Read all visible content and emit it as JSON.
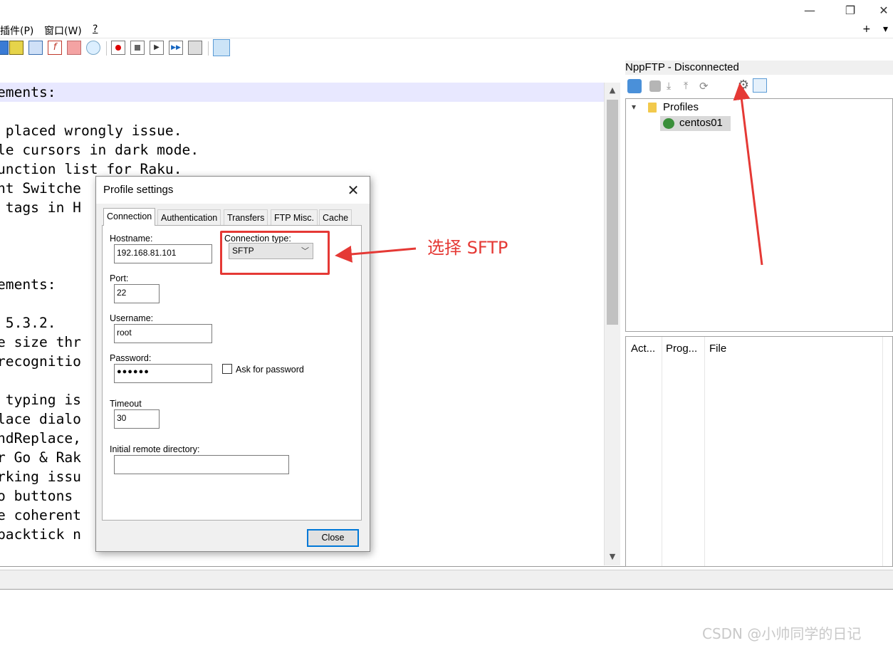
{
  "menubar": {
    "items": [
      "插件(P)",
      "窗口(W)",
      "?"
    ]
  },
  "window": {
    "minimize": "—",
    "restore": "❐",
    "close": "✕",
    "tab_add": "+",
    "tab_list": "▾"
  },
  "editor": {
    "lines": [
      "ements:",
      "",
      " placed wrongly issue.",
      "le cursors in dark mode.",
      "unction list for Raku.",
      "nt Switche",
      " tags in H",
      "",
      "",
      "",
      "ements:",
      "",
      " 5.3.2.",
      "e size thr",
      "recognitio",
      "",
      " typing is",
      "lace dialo",
      "ndReplace,                   s.",
      "r Go & Rak",
      "rking issu",
      "o buttons",
      "e coherent",
      "backtick n"
    ]
  },
  "nppftp": {
    "title": "NppFTP - Disconnected",
    "tree": {
      "root": "Profiles",
      "profile": "centos01"
    },
    "queue_columns": [
      "Act...",
      "Prog...",
      "File"
    ]
  },
  "dialog": {
    "title": "Profile settings",
    "tabs": [
      "Connection",
      "Authentication",
      "Transfers",
      "FTP Misc.",
      "Cache"
    ],
    "hostname_label": "Hostname:",
    "hostname": "192.168.81.101",
    "connection_type_label": "Connection type:",
    "connection_type": "SFTP",
    "port_label": "Port:",
    "port": "22",
    "username_label": "Username:",
    "username": "root",
    "password_label": "Password:",
    "password": "●●●●●●",
    "ask_password_label": "Ask for password",
    "timeout_label": "Timeout",
    "timeout": "30",
    "remote_dir_label": "Initial remote directory:",
    "remote_dir": "",
    "close_label": "Close"
  },
  "annotation": {
    "text": "选择 SFTP",
    "color": "#e53935"
  },
  "watermark": "CSDN @小帅同学的日记"
}
